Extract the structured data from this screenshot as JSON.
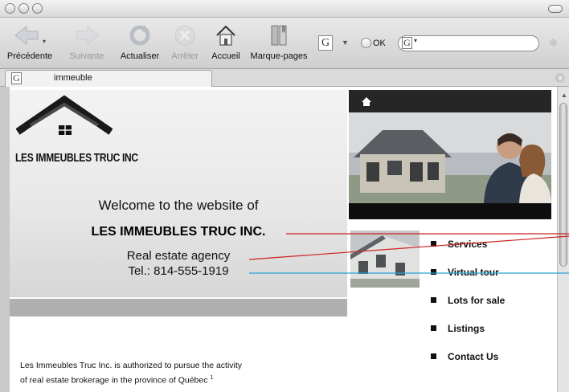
{
  "toolbar": {
    "back": "Précédente",
    "forward": "Suivante",
    "reload": "Actualiser",
    "stop": "Arrêter",
    "home": "Accueil",
    "bookmarks": "Marque-pages",
    "google_letter": "G",
    "ok": "OK"
  },
  "tab": {
    "favicon_letter": "G",
    "title": "immeuble"
  },
  "page": {
    "logo_text": "LES IMMEUBLES TRUC INC",
    "welcome": "Welcome to the website of",
    "company": "LES IMMEUBLES TRUC INC.",
    "agency": "Real estate agency",
    "tel": "Tel.: 814-555-1919",
    "auth_line1": "Les Immeubles Truc Inc. is authorized to pursue the activity",
    "auth_line2": "of real estate brokerage in the province of Québec",
    "auth_note": "1",
    "menu": [
      "Services",
      "Virtual tour",
      "Lots for sale",
      "Listings",
      "Contact Us"
    ]
  },
  "colors": {
    "annotation_red": "#cc2222",
    "annotation_blue": "#2a9fd6"
  }
}
